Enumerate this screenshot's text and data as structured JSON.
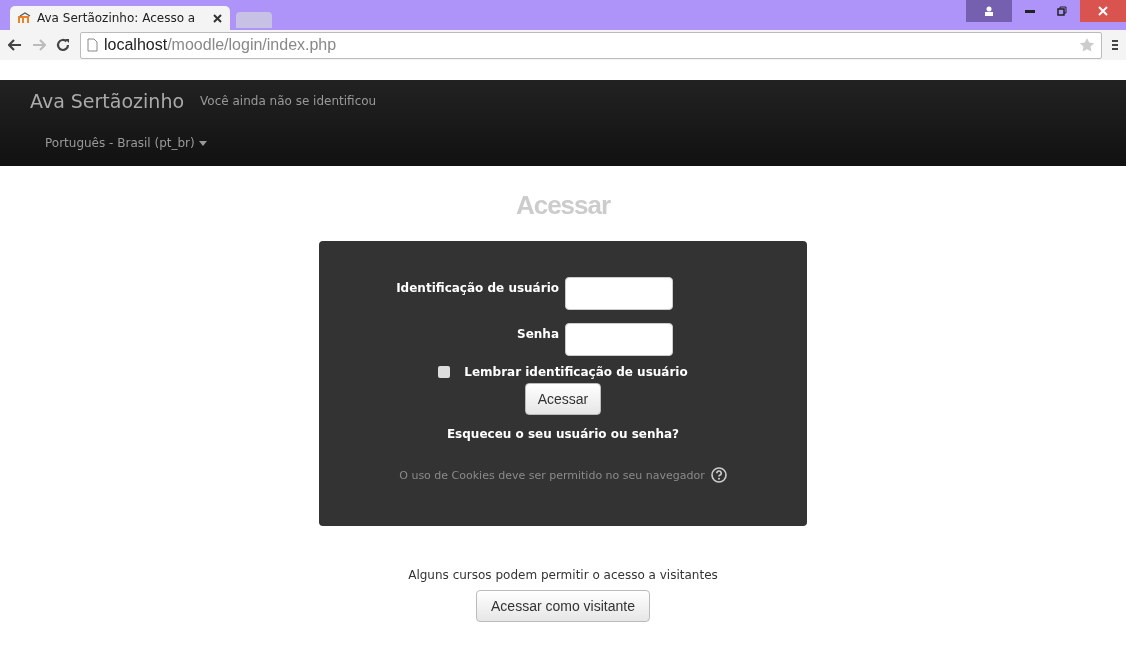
{
  "browser": {
    "tab_title": "Ava Sertãozinho: Acesso a",
    "url_host": "localhost",
    "url_path": "/moodle/login/index.php"
  },
  "navbar": {
    "brand": "Ava Sertãozinho",
    "login_info": "Você ainda não se identificou",
    "language": "Português - Brasil (pt_br)"
  },
  "heading": "Acessar",
  "login": {
    "username_label": "Identificação de usuário",
    "password_label": "Senha",
    "remember": {
      "label": "Lembrar identificação de usuário",
      "checked": false
    },
    "submit": "Acessar",
    "forgot": "Esqueceu o seu usuário ou senha?",
    "cookies_notice": "O uso de Cookies deve ser permitido no seu navegador"
  },
  "guest": {
    "notice": "Alguns cursos podem permitir o acesso a visitantes",
    "button": "Acessar como visitante"
  }
}
